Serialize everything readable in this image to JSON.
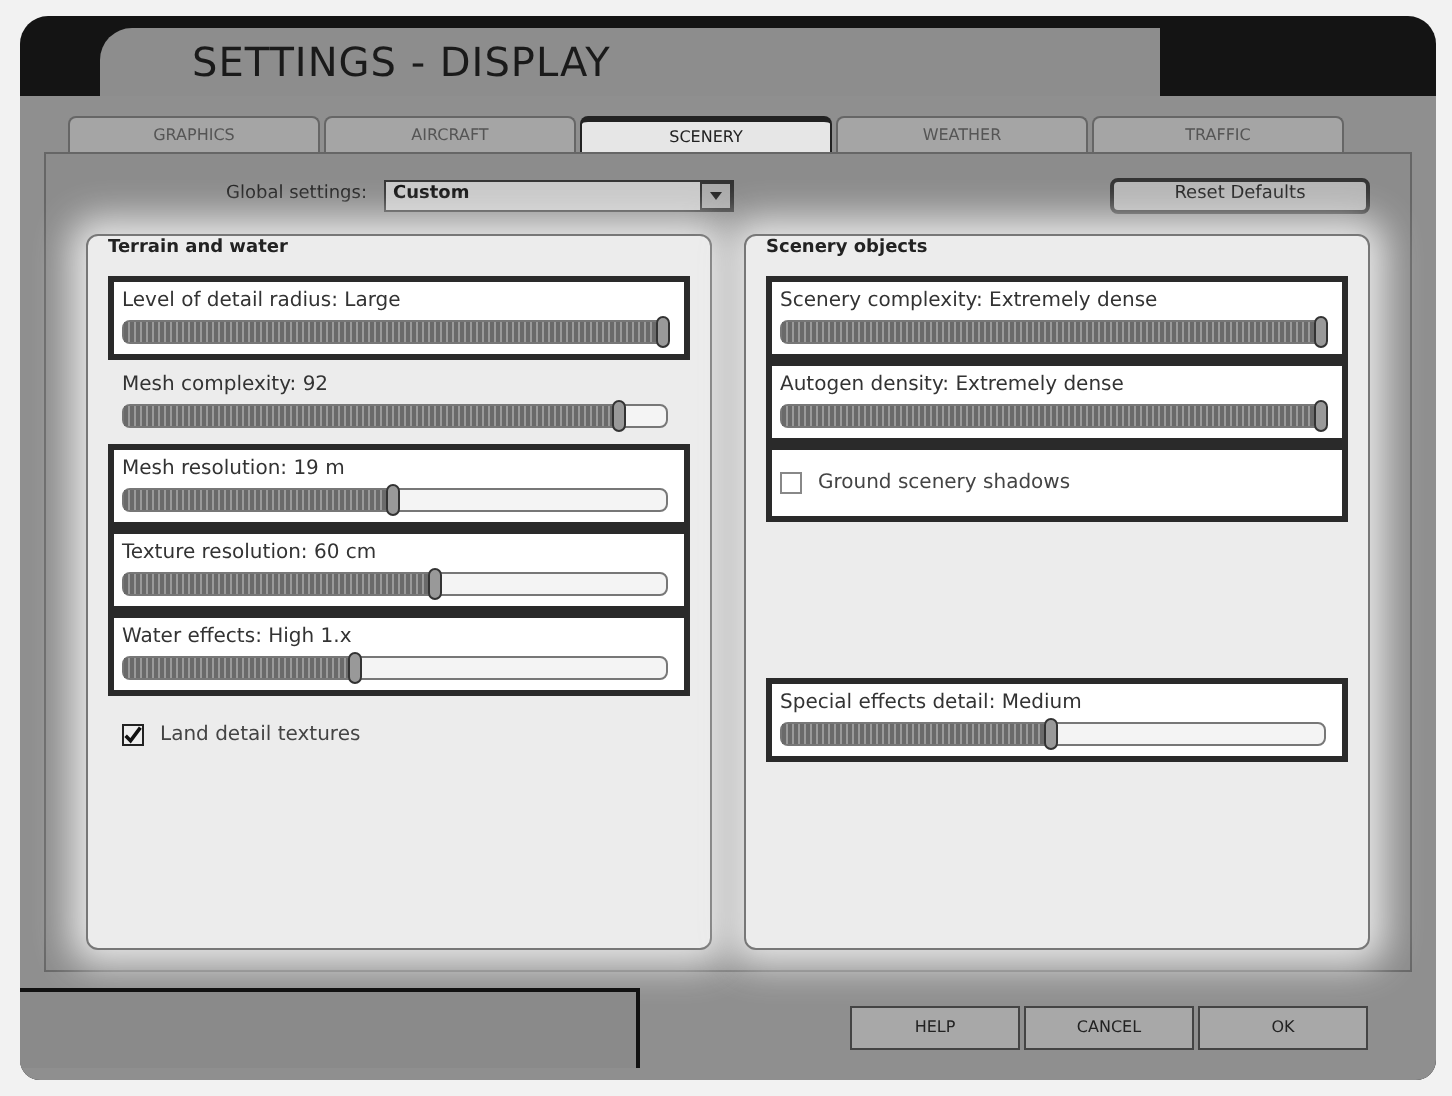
{
  "window": {
    "title": "SETTINGS - DISPLAY"
  },
  "tabs": [
    {
      "label": "GRAPHICS",
      "selected": false
    },
    {
      "label": "AIRCRAFT",
      "selected": false
    },
    {
      "label": "SCENERY",
      "selected": true
    },
    {
      "label": "WEATHER",
      "selected": false
    },
    {
      "label": "TRAFFIC",
      "selected": false
    }
  ],
  "global_settings": {
    "label": "Global settings:",
    "value": "Custom"
  },
  "reset_button": "Reset Defaults",
  "groups": [
    {
      "title": "Terrain and water",
      "items": [
        {
          "kind": "slider",
          "label": "Level of detail radius: Large",
          "level": 1,
          "highlighted": true
        },
        {
          "kind": "slider",
          "label": "Mesh complexity: 92",
          "level": 0.92,
          "highlighted": false
        },
        {
          "kind": "slider",
          "label": "Mesh resolution: 19 m",
          "level": 0.5,
          "highlighted": true
        },
        {
          "kind": "slider",
          "label": "Texture resolution: 60 cm",
          "level": 0.58,
          "highlighted": true
        },
        {
          "kind": "slider",
          "label": "Water effects: High 1.x",
          "level": 0.43,
          "highlighted": true
        },
        {
          "kind": "checkbox",
          "label": "Land detail textures",
          "checked": true,
          "highlighted": false
        }
      ]
    },
    {
      "title": "Scenery objects",
      "items": [
        {
          "kind": "slider",
          "label": "Scenery complexity: Extremely dense",
          "level": 1,
          "highlighted": true
        },
        {
          "kind": "slider",
          "label": "Autogen density: Extremely dense",
          "level": 1,
          "highlighted": true
        },
        {
          "kind": "checkbox",
          "label": "Ground scenery shadows",
          "checked": false,
          "highlighted": true
        },
        {
          "kind": "spacer"
        },
        {
          "kind": "slider",
          "label": "Special effects detail: Medium",
          "level": 0.5,
          "highlighted": true
        }
      ]
    }
  ],
  "buttons": [
    "HELP",
    "CANCEL",
    "OK"
  ]
}
